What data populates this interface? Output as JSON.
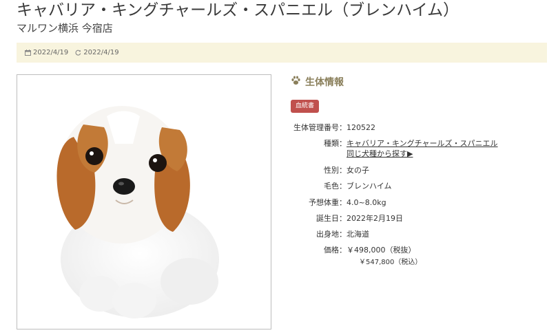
{
  "title": "キャバリア・キングチャールズ・スパニエル（ブレンハイム）",
  "shop": "マルワン横浜 今宿店",
  "dates": {
    "published": "2022/4/19",
    "updated": "2022/4/19",
    "published_icon": "calendar-icon",
    "updated_icon": "refresh-icon"
  },
  "photo": {
    "subject": "puppy-photo"
  },
  "info": {
    "heading": "生体情報",
    "heading_icon": "paw-icon",
    "badge": "血統書",
    "badge_color": "#c0504d",
    "accent_color": "#8a7f5b",
    "date_bar_color": "#f8f4de"
  },
  "specs": {
    "id_label": "生体管理番号：",
    "id_value": "120522",
    "breed_label": "種類：",
    "breed_value": "キャバリア・キングチャールズ・スパニエル",
    "breed_link": "同じ犬種から探す▶",
    "sex_label": "性別：",
    "sex_value": "女の子",
    "color_label": "毛色：",
    "color_value": "ブレンハイム",
    "weight_label": "予想体重：",
    "weight_value": "4.0~8.0kg",
    "birth_label": "誕生日：",
    "birth_value": "2022年2月19日",
    "origin_label": "出身地：",
    "origin_value": "北海道",
    "price_label": "価格：",
    "price_value": "￥498,000（税抜）",
    "price_tax": "￥547,800（税込）"
  }
}
